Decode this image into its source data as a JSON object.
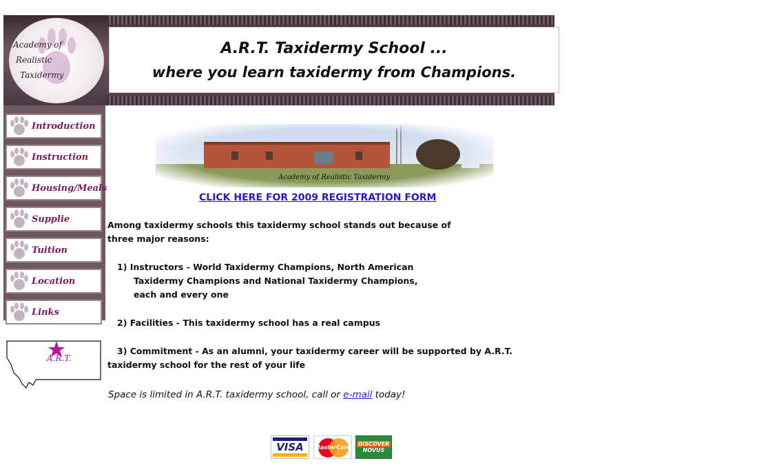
{
  "header": {
    "logo_lines": [
      "Academy of",
      "Realistic",
      "Taxidermy"
    ],
    "title_line1": "A.R.T. Taxidermy School ...",
    "title_line2": "where you learn taxidermy from Champions."
  },
  "sidebar": {
    "items": [
      {
        "label": "Introduction"
      },
      {
        "label": "Instruction"
      },
      {
        "label": "Housing/Meals"
      },
      {
        "label": "Supplie"
      },
      {
        "label": "Tuition"
      },
      {
        "label": "Location"
      },
      {
        "label": "Links"
      }
    ],
    "map_label": "A.R.T."
  },
  "main": {
    "photo_caption": "Academy of Realistic Taxidermy",
    "registration_link": "CLICK HERE FOR 2009 REGISTRATION FORM",
    "intro_pre": "Among taxidermy schools this taxidermy school ",
    "intro_link": "stands out",
    "intro_post": " because of",
    "intro_line2": "three major reasons:",
    "reason1_line1": "1) Instructors - World Taxidermy Champions, North American",
    "reason1_line2": "Taxidermy Champions and National Taxidermy Champions,",
    "reason1_line3": "each and every one",
    "reason2": "2) Facilities - This taxidermy school has a real campus",
    "reason3_line1": "3) Commitment - As an alumni, your taxidermy career will be supported by A.R.T.",
    "reason3_line2": "taxidermy school for the rest of your life",
    "limited_pre": "Space is limited in A.R.T. taxidermy school, call or ",
    "limited_link": "e-mail",
    "limited_post": " today!"
  },
  "payment": {
    "visa": "VISA",
    "mastercard": "MasterCard",
    "discover_top": "DISCOVER",
    "discover_bottom": "NOVUS"
  }
}
